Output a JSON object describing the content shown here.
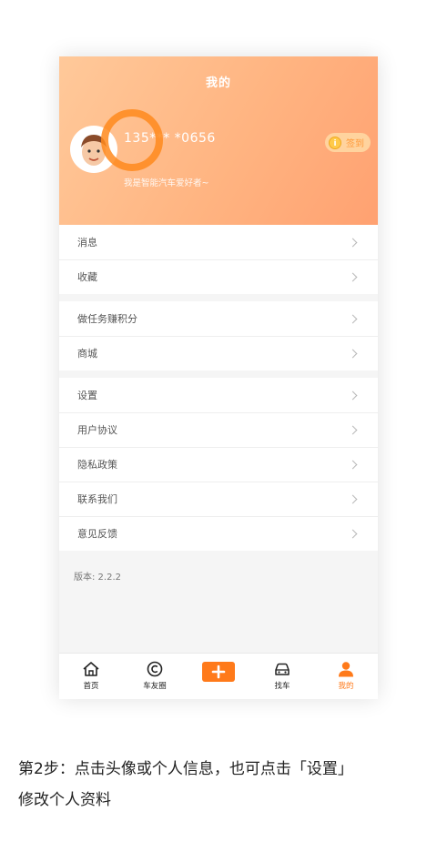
{
  "header": {
    "title": "我的",
    "phone": "135*** *0656",
    "bio": "我是智能汽车爱好者~",
    "checkin_label": "签到",
    "coin_symbol": "i"
  },
  "menu_groups": [
    [
      "消息",
      "收藏"
    ],
    [
      "做任务赚积分",
      "商城"
    ],
    [
      "设置",
      "用户协议",
      "隐私政策",
      "联系我们",
      "意见反馈"
    ]
  ],
  "version": "版本: 2.2.2",
  "tabs": [
    {
      "label": "首页",
      "icon": "home-icon"
    },
    {
      "label": "车友圈",
      "icon": "circle-c-icon"
    },
    {
      "label": "",
      "icon": "plus-icon"
    },
    {
      "label": "找车",
      "icon": "car-icon"
    },
    {
      "label": "我的",
      "icon": "person-icon",
      "active": true
    }
  ],
  "colors": {
    "accent": "#ff7a1a",
    "header_start": "#ffc99a",
    "header_end": "#ffa171"
  },
  "caption": {
    "line1": "第2步：点击头像或个人信息，也可点击「设置」",
    "line2": "修改个人资料"
  }
}
